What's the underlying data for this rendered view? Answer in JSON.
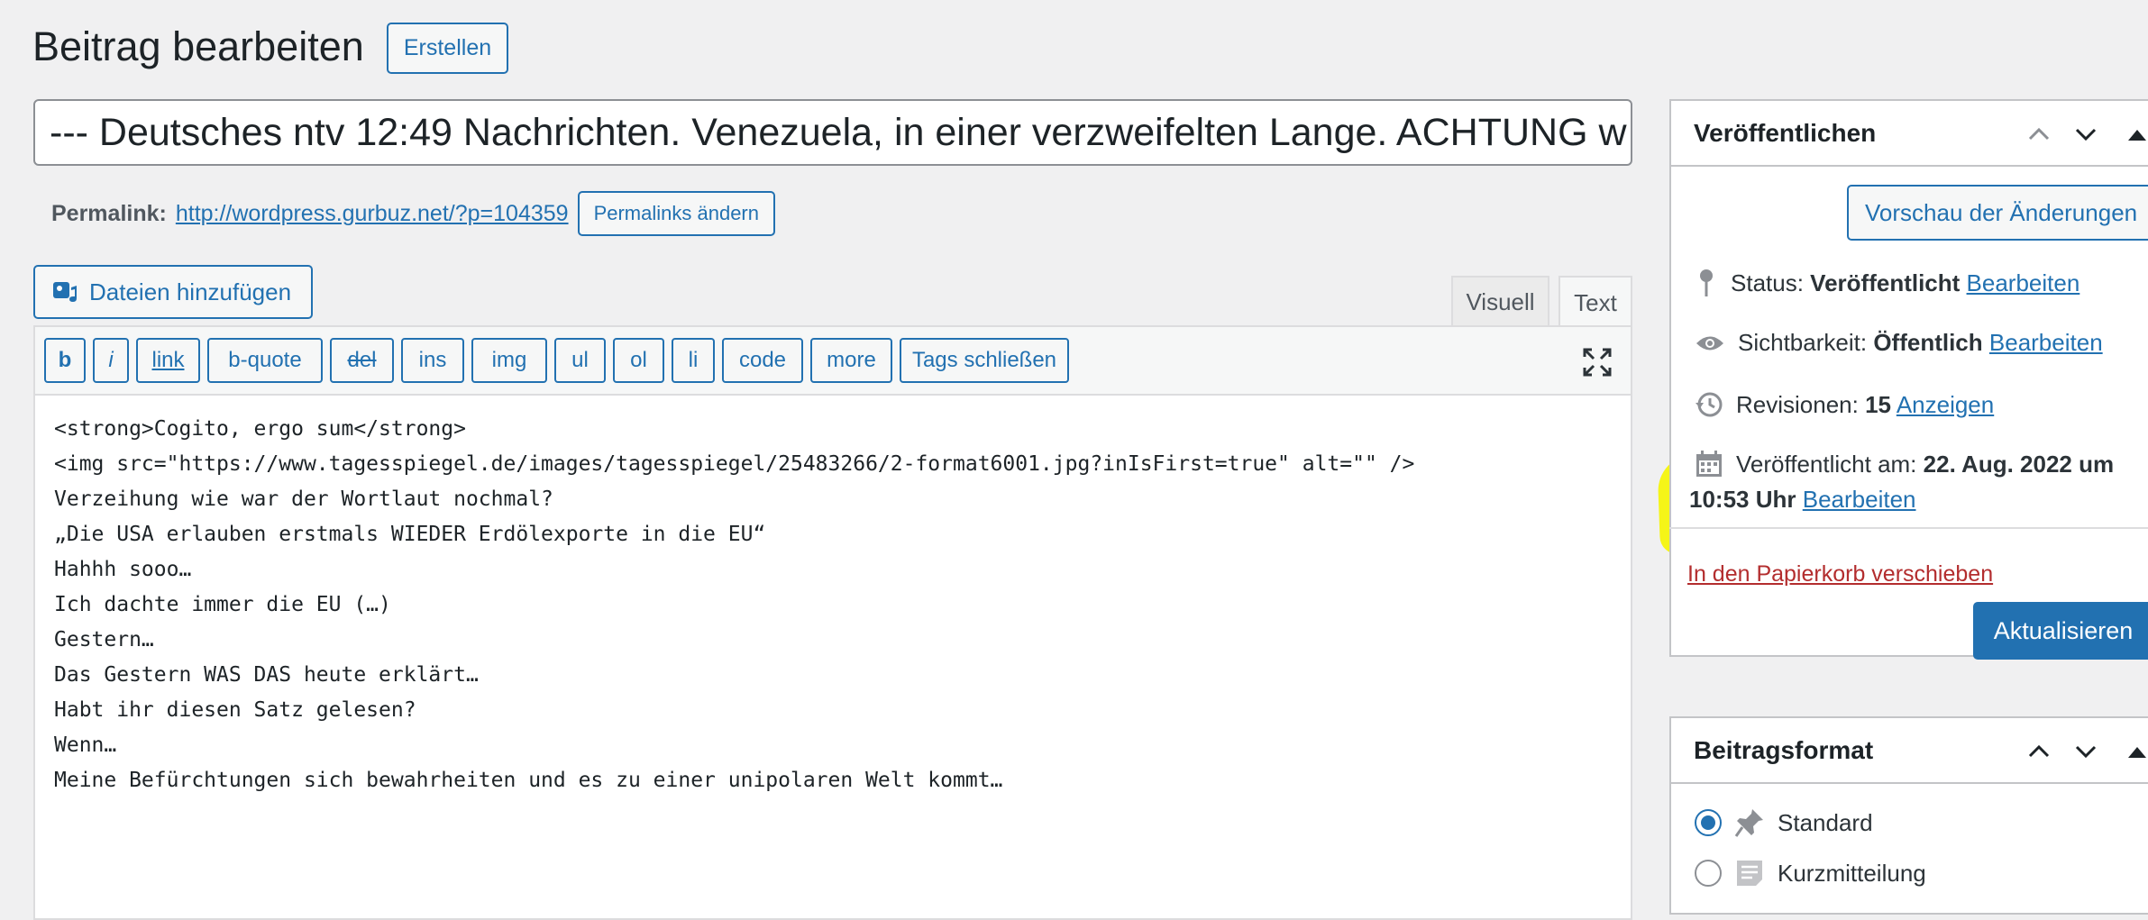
{
  "header": {
    "title": "Beitrag bearbeiten",
    "create_label": "Erstellen"
  },
  "post": {
    "title_value": "--- Deutsches ntv 12:49 Nachrichten. Venezuela, in einer verzweifelten Lange. ACHTUNG w",
    "permalink_label": "Permalink:",
    "permalink_url": "http://wordpress.gurbuz.net/?p=104359",
    "permalink_button": "Permalinks ändern"
  },
  "editor": {
    "add_media_label": "Dateien hinzufügen",
    "tab_visual": "Visuell",
    "tab_text": "Text",
    "quicktags": [
      "b",
      "i",
      "link",
      "b-quote",
      "del",
      "ins",
      "img",
      "ul",
      "ol",
      "li",
      "code",
      "more",
      "Tags schließen"
    ],
    "content_lines": [
      "<strong>Cogito, ergo sum</strong>",
      "<img src=\"https://www.tagesspiegel.de/images/tagesspiegel/25483266/2-format6001.jpg?inIsFirst=true\" alt=\"\" />",
      "",
      "Verzeihung wie war der Wortlaut nochmal?",
      "„Die USA erlauben erstmals WIEDER Erdölexporte in die EU“",
      "Hahhh sooo…",
      "Ich dachte immer die EU (…)",
      "",
      "Gestern…",
      "Das Gestern WAS DAS heute erklärt…",
      "Habt ihr diesen Satz gelesen?",
      "",
      "Wenn…",
      "Meine Befürchtungen sich bewahrheiten und es zu einer unipolaren Welt kommt…"
    ]
  },
  "publish": {
    "heading": "Veröffentlichen",
    "preview_label": "Vorschau der Änderungen",
    "status_label": "Status:",
    "status_value": "Veröffentlicht",
    "visibility_label": "Sichtbarkeit:",
    "visibility_value": "Öffentlich",
    "revisions_label": "Revisionen:",
    "revisions_value": "15",
    "revisions_link": "Anzeigen",
    "published_label": "Veröffentlicht am:",
    "published_value": "22. Aug. 2022 um",
    "published_time": "10:53 Uhr",
    "edit_link": "Bearbeiten",
    "trash_label": "In den Papierkorb verschieben",
    "update_label": "Aktualisieren"
  },
  "format": {
    "heading": "Beitragsformat",
    "options": [
      {
        "label": "Standard",
        "checked": true
      },
      {
        "label": "Kurzmitteilung",
        "checked": false
      }
    ]
  },
  "colors": {
    "accent": "#2271b1",
    "highlight": "#f5f518",
    "danger": "#b32d2e"
  }
}
